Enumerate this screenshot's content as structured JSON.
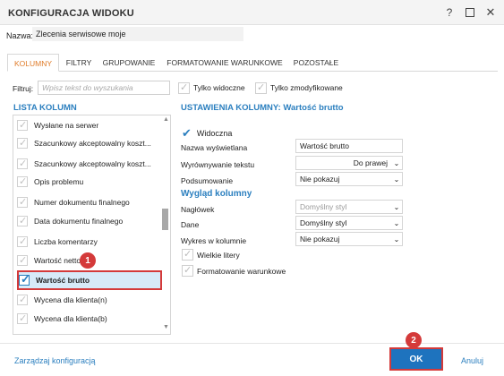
{
  "window": {
    "title": "KONFIGURACJA WIDOKU",
    "help": "?",
    "close": "✕"
  },
  "name_field": {
    "label": "Nazwa:",
    "value": "Zlecenia serwisowe moje"
  },
  "tabs": [
    {
      "label": "KOLUMNY",
      "active": true
    },
    {
      "label": "FILTRY"
    },
    {
      "label": "GRUPOWANIE"
    },
    {
      "label": "FORMATOWANIE WARUNKOWE"
    },
    {
      "label": "POZOSTAŁE"
    }
  ],
  "filter": {
    "label": "Filtruj:",
    "placeholder": "Wpisz tekst do wyszukania",
    "only_visible": "Tylko widoczne",
    "only_modified": "Tylko zmodyfikowane"
  },
  "column_list": {
    "title": "LISTA KOLUMN",
    "items": [
      "Wysłane na serwer",
      "Szacunkowy akceptowalny koszt...",
      "Szacunkowy akceptowalny koszt...",
      "Opis problemu",
      "Numer dokumentu finalnego",
      "Data dokumentu finalnego",
      "Liczba komentarzy",
      "Wartość netto",
      "Wartość brutto",
      "Wycena dla klienta(n)",
      "Wycena dla klienta(b)"
    ],
    "selected_index": 8
  },
  "badges": {
    "first": "1",
    "second": "2"
  },
  "settings": {
    "title": "USTAWIENIA KOLUMNY: Wartość brutto",
    "visible_label": "Widoczna",
    "display_name_label": "Nazwa wyświetlana",
    "display_name_value": "Wartość brutto",
    "alignment_label": "Wyrównywanie tekstu",
    "alignment_value": "Do prawej",
    "summary_label": "Podsumowanie",
    "summary_value": "Nie pokazuj",
    "appearance_title": "Wygląd kolumny",
    "header_label": "Nagłówek",
    "header_value": "Domyślny styl",
    "data_label": "Dane",
    "data_value": "Domyślny styl",
    "chart_label": "Wykres w kolumnie",
    "chart_value": "Nie pokazuj",
    "uppercase_label": "Wielkie litery",
    "conditional_label": "Formatowanie warunkowe"
  },
  "footer": {
    "manage_label": "Zarządzaj konfiguracją",
    "ok_label": "OK",
    "cancel_label": "Anuluj"
  },
  "colors": {
    "accent": "#2b7fbf",
    "active_tab": "#e07c2a",
    "highlight": "#d43a3a",
    "ok_button": "#1e73be"
  }
}
